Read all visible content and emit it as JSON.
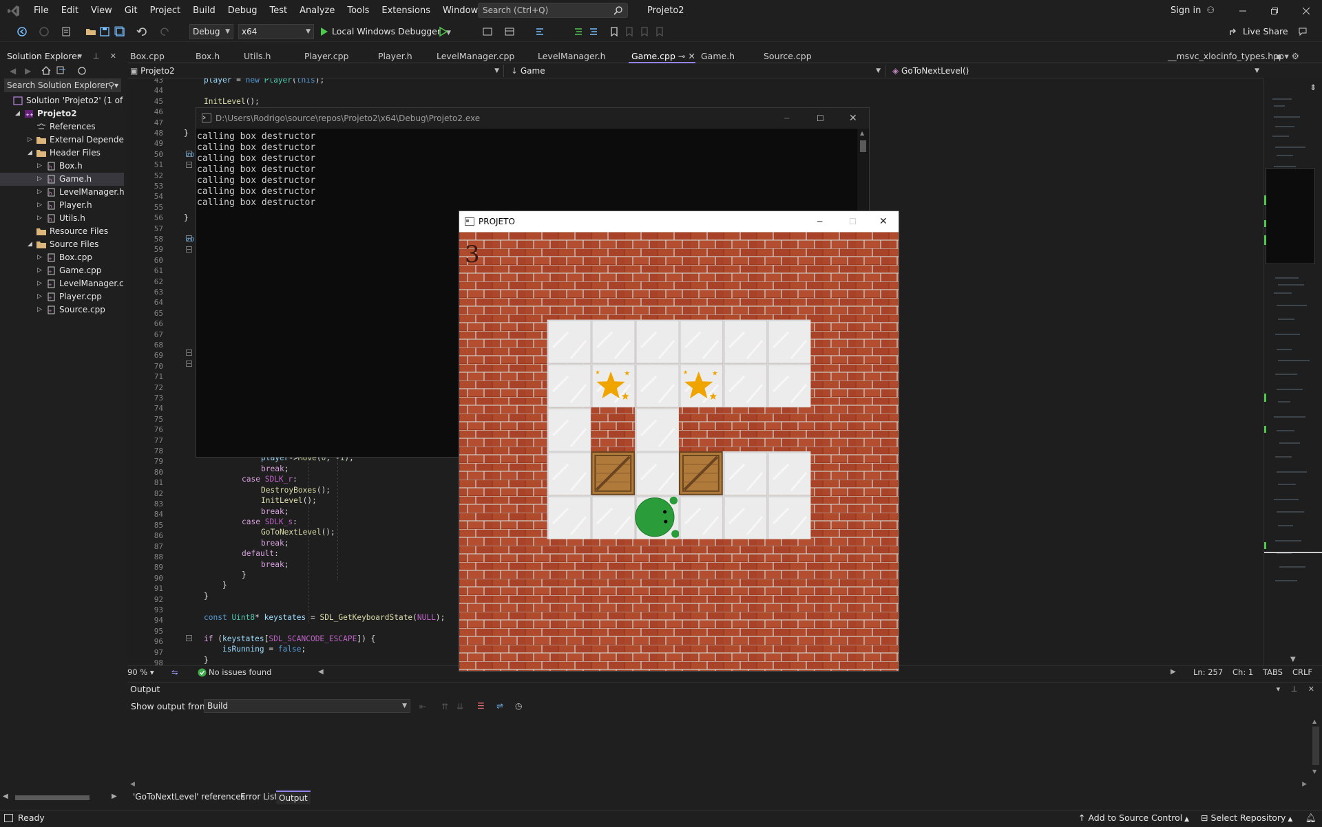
{
  "app": {
    "menu": [
      "File",
      "Edit",
      "View",
      "Git",
      "Project",
      "Build",
      "Debug",
      "Test",
      "Analyze",
      "Tools",
      "Extensions",
      "Window",
      "Help"
    ],
    "search_placeholder": "Search (Ctrl+Q)",
    "solution_title": "Projeto2",
    "sign_in": "Sign in",
    "live_share": "Live Share"
  },
  "toolbar": {
    "config": "Debug",
    "platform": "x64",
    "debugger": "Local Windows Debugger"
  },
  "solution_explorer": {
    "title": "Solution Explorer",
    "search_placeholder": "Search Solution Explorer",
    "tree": [
      {
        "label": "Solution 'Projeto2' (1 of 1",
        "indent": 0,
        "icon": "solution-icon",
        "twisty": ""
      },
      {
        "label": "Projeto2",
        "indent": 1,
        "icon": "cpp-project-icon",
        "twisty": "◢",
        "bold": true
      },
      {
        "label": "References",
        "indent": 2,
        "icon": "references-icon",
        "twisty": ""
      },
      {
        "label": "External Dependen",
        "indent": 2,
        "icon": "folder-icon",
        "twisty": "▷"
      },
      {
        "label": "Header Files",
        "indent": 2,
        "icon": "folder-icon",
        "twisty": "◢"
      },
      {
        "label": "Box.h",
        "indent": 3,
        "icon": "header-file-icon",
        "twisty": "▷"
      },
      {
        "label": "Game.h",
        "indent": 3,
        "icon": "header-file-icon",
        "twisty": "▷",
        "selected": true
      },
      {
        "label": "LevelManager.h",
        "indent": 3,
        "icon": "header-file-icon",
        "twisty": "▷"
      },
      {
        "label": "Player.h",
        "indent": 3,
        "icon": "header-file-icon",
        "twisty": "▷"
      },
      {
        "label": "Utils.h",
        "indent": 3,
        "icon": "header-file-icon",
        "twisty": "▷"
      },
      {
        "label": "Resource Files",
        "indent": 2,
        "icon": "folder-icon",
        "twisty": ""
      },
      {
        "label": "Source Files",
        "indent": 2,
        "icon": "folder-icon",
        "twisty": "◢"
      },
      {
        "label": "Box.cpp",
        "indent": 3,
        "icon": "cpp-file-icon",
        "twisty": "▷"
      },
      {
        "label": "Game.cpp",
        "indent": 3,
        "icon": "cpp-file-icon",
        "twisty": "▷"
      },
      {
        "label": "LevelManager.c",
        "indent": 3,
        "icon": "cpp-file-icon",
        "twisty": "▷"
      },
      {
        "label": "Player.cpp",
        "indent": 3,
        "icon": "cpp-file-icon",
        "twisty": "▷"
      },
      {
        "label": "Source.cpp",
        "indent": 3,
        "icon": "cpp-file-icon",
        "twisty": "▷"
      }
    ]
  },
  "tabs": [
    "Box.cpp",
    "Box.h",
    "Utils.h",
    "Player.cpp",
    "Player.h",
    "LevelManager.cpp",
    "LevelManager.h",
    "Game.cpp",
    "Game.h",
    "Source.cpp"
  ],
  "active_tab": "Game.cpp",
  "right_tab": "__msvc_xlocinfo_types.hpp",
  "navbar": {
    "project": "Projeto2",
    "scope": "Game",
    "member": "GoToNextLevel()"
  },
  "editor": {
    "line_numbers": [
      "43",
      "44",
      "45",
      "46",
      "47",
      "48",
      "49",
      "50",
      "51",
      "52",
      "53",
      "54",
      "55",
      "56",
      "57",
      "58",
      "59",
      "60",
      "61",
      "62",
      "63",
      "64",
      "65",
      "66",
      "67",
      "68",
      "69",
      "70",
      "71",
      "72",
      "73",
      "74",
      "75",
      "76",
      "77",
      "78",
      "79",
      "80",
      "81",
      "82",
      "83",
      "84",
      "85",
      "86",
      "87",
      "88",
      "89",
      "90",
      "91",
      "92",
      "93",
      "94",
      "95",
      "96",
      "97",
      "98"
    ],
    "zoom": "90 %",
    "issues": "No issues found",
    "line": "Ln: 257",
    "col": "Ch: 1",
    "tabs": "TABS",
    "eol": "CRLF"
  },
  "console": {
    "title": "D:\\Users\\Rodrigo\\source\\repos\\Projeto2\\x64\\Debug\\Projeto2.exe",
    "lines": [
      "calling box destructor",
      "calling box destructor",
      "calling box destructor",
      "calling box destructor",
      "calling box destructor",
      "calling box destructor",
      "calling box destructor"
    ]
  },
  "game": {
    "title": "PROJETO",
    "level": "3",
    "grid": [
      "WWWWWWWWWW",
      "WWWWWWWWWW",
      "WWFFFFFFWW",
      "WWFSFSFFWW",
      "WWFWFWWWWW",
      "WWFBFBFFWW",
      "WWFFPFFFWW",
      "WWWWWWWWWW",
      "WWWWWWWWWW",
      "WWWWWWWWWW"
    ]
  },
  "output": {
    "title": "Output",
    "show_from_label": "Show output from:",
    "source": "Build"
  },
  "bottom_tabs": [
    "'GoToNextLevel' references",
    "Error List",
    "Output"
  ],
  "status": {
    "ready": "Ready",
    "source_control": "Add to Source Control",
    "repository": "Select Repository"
  },
  "colors": {
    "accent": "#9184ee",
    "brick": "#a83a22",
    "floor": "#e6e6e6",
    "player": "#2a9d3a",
    "star": "#f0a400",
    "crate": "#b07a3a"
  }
}
